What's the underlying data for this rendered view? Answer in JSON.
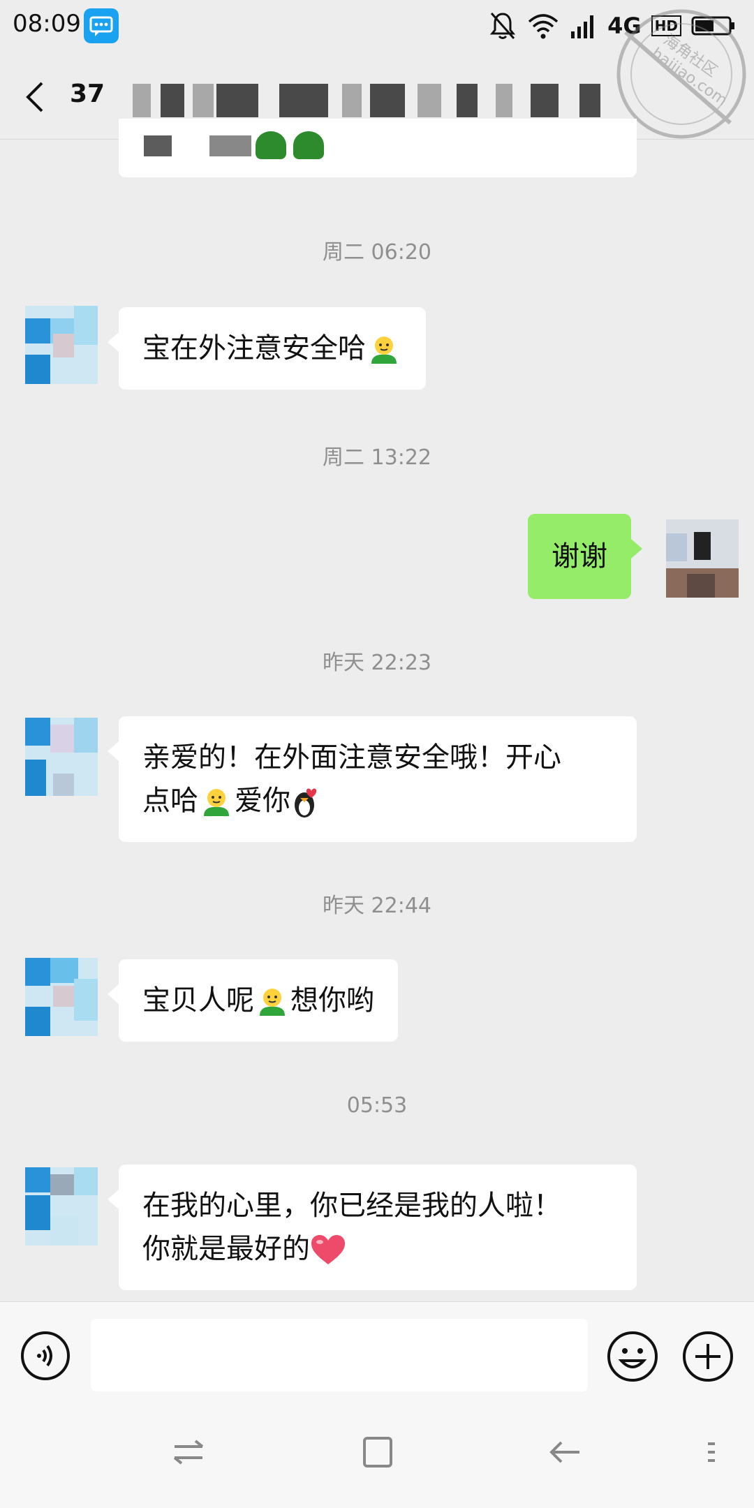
{
  "status_bar": {
    "time": "08:09",
    "network": "4G",
    "hd_label": "HD"
  },
  "nav": {
    "unread_count": "37"
  },
  "watermark": {
    "line1": "海角社区",
    "line2": "haijiao.com"
  },
  "messages": [
    {
      "type": "timestamp",
      "text": "周二 06:20"
    },
    {
      "type": "incoming",
      "text": "宝在外注意安全哈"
    },
    {
      "type": "timestamp",
      "text": "周二 13:22"
    },
    {
      "type": "outgoing",
      "text": "谢谢"
    },
    {
      "type": "timestamp",
      "text": "昨天 22:23"
    },
    {
      "type": "incoming",
      "line1": "亲爱的！在外面注意安全哦！开心",
      "line2a": "点哈",
      "line2b": "爱你"
    },
    {
      "type": "timestamp",
      "text": "昨天 22:44"
    },
    {
      "type": "incoming",
      "text_a": "宝贝人呢",
      "text_b": "想你哟"
    },
    {
      "type": "timestamp",
      "text": "05:53"
    },
    {
      "type": "incoming",
      "line1": "在我的心里，你已经是我的人啦！",
      "line2": "你就是最好的"
    }
  ],
  "input": {
    "value": "",
    "placeholder": ""
  },
  "icons": {
    "back": "chevron-left-icon",
    "voice": "voice-icon",
    "emoji": "smiley-icon",
    "plus": "plus-icon",
    "mute": "bell-off-icon",
    "wifi": "wifi-icon",
    "signal": "signal-icon",
    "battery": "battery-icon"
  },
  "colors": {
    "background": "#ededed",
    "outgoing_bubble": "#95ec69",
    "incoming_bubble": "#ffffff",
    "timestamp_text": "#8f8f8f"
  }
}
